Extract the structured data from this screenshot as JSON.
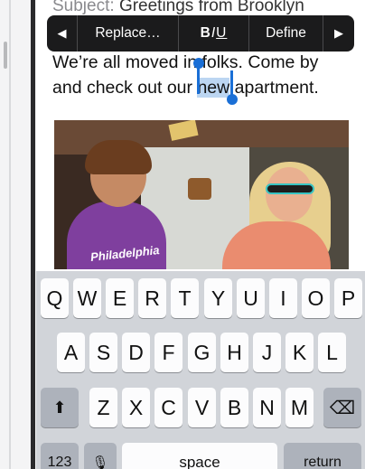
{
  "mail": {
    "subject_label": "Subject:",
    "subject_value": "Greetings from Brooklyn",
    "body_before": "We’re all moved in folks. Come by",
    "line2_before": "and check out our ",
    "selected_word": "new",
    "line2_after": " apartment."
  },
  "photo": {
    "shirt_text": "Philadelphia"
  },
  "edit_menu": {
    "prev_arrow": "◀",
    "replace_label": "Replace…",
    "bold": "B",
    "italic": "I",
    "underline": "U",
    "define_label": "Define",
    "next_arrow": "▶"
  },
  "keyboard": {
    "row1": [
      "Q",
      "W",
      "E",
      "R",
      "T",
      "Y",
      "U",
      "I",
      "O",
      "P"
    ],
    "row2": [
      "A",
      "S",
      "D",
      "F",
      "G",
      "H",
      "J",
      "K",
      "L"
    ],
    "row3": [
      "Z",
      "X",
      "C",
      "V",
      "B",
      "N",
      "M"
    ],
    "shift_icon": "⬆",
    "delete_icon": "⌫",
    "numbers_label": "123",
    "dictation_icon": "🎙",
    "space_label": "space",
    "return_label": "return"
  }
}
